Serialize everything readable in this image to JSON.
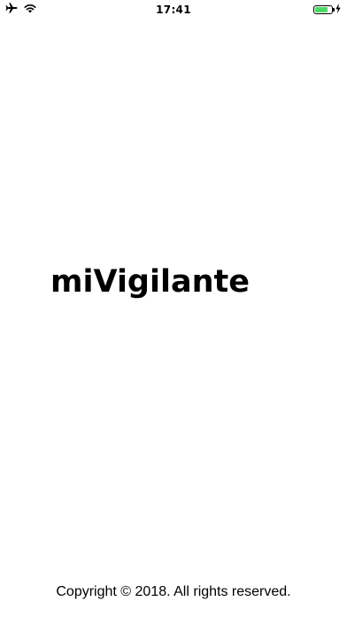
{
  "status_bar": {
    "time": "17:41",
    "icons": [
      "airplane-icon",
      "wifi-icon",
      "battery-icon",
      "charging-bolt-icon"
    ],
    "battery_level": 0.8,
    "battery_color": "#4cd964"
  },
  "splash": {
    "app_name": "miVigilante",
    "copyright": "Copyright © 2018. All rights reserved."
  }
}
